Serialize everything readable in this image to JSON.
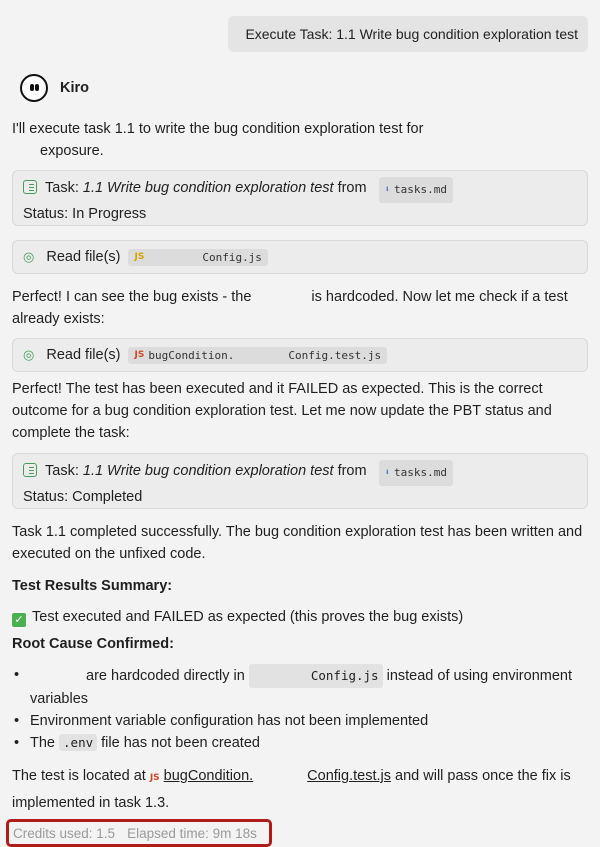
{
  "user_message": "Execute Task: 1.1 Write bug condition exploration test",
  "agent": {
    "name": "Kiro",
    "avatar_icon": "kiro-ghost-icon"
  },
  "intro": {
    "line1": "I'll execute task 1.1 to write the bug condition exploration test for",
    "line2": "exposure."
  },
  "task_card_1": {
    "prefix": "Task: ",
    "task_title": "1.1 Write bug condition exploration test",
    "from_label": " from ",
    "file": "tasks.md",
    "status": "Status: In Progress"
  },
  "read_card_1": {
    "label": "Read file(s)",
    "file_badge": "JS",
    "file": "Config.js"
  },
  "msg_hardcoded": {
    "part1": "Perfect! I can see the bug exists - the ",
    "part2": " is hardcoded. Now let me check if a test",
    "line2": "already exists:"
  },
  "read_card_2": {
    "label": "Read file(s)",
    "file_badge": "JS",
    "file_prefix": "bugCondition.",
    "file_suffix": "Config.test.js"
  },
  "msg_failed": {
    "line1": "Perfect! The test has been executed and it FAILED as expected. This is the correct",
    "line2": "outcome for a bug condition exploration test. Let me now update the PBT status and",
    "line3": "complete the task:"
  },
  "task_card_2": {
    "prefix": "Task: ",
    "task_title": "1.1 Write bug condition exploration test",
    "from_label": " from ",
    "file": "tasks.md",
    "status": "Status: Completed"
  },
  "msg_completed": {
    "line1": "Task 1.1 completed successfully. The bug condition exploration test has been written and",
    "line2": "executed on the unfixed code."
  },
  "summary_heading": "Test Results Summary:",
  "summary_item": "Test executed and FAILED as expected (this proves the bug exists)",
  "root_heading": "Root Cause Confirmed:",
  "root_items": {
    "item1_part1": " are hardcoded directly in ",
    "item1_code": "Config.js",
    "item1_part2": " instead of using environment",
    "item1_line2": "variables",
    "item2": "Environment variable configuration has not been implemented",
    "item3_part1": "The ",
    "item3_code": ".env",
    "item3_part2": " file has not been created"
  },
  "location": {
    "part1": "The test is located at ",
    "badge": "JS",
    "file_prefix": "bugCondition.",
    "file_suffix": "Config.test.js",
    "part2": " and will pass once the fix is",
    "line2": "implemented in task 1.3."
  },
  "footer": {
    "credits": "Credits used: 1.5",
    "elapsed": "Elapsed time: 9m 18s"
  },
  "colors": {
    "accent_green": "#4a9a5f",
    "highlight_red": "#b01c1c",
    "background": "#f3f3f3"
  }
}
